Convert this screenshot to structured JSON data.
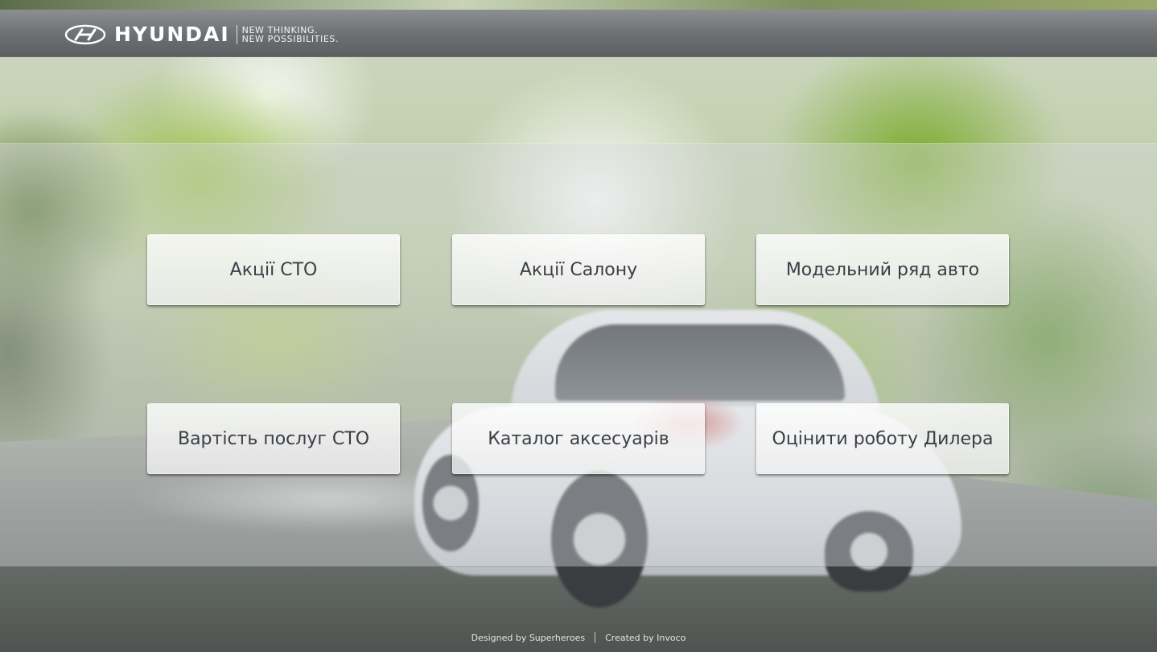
{
  "header": {
    "brand": "HYUNDAI",
    "tagline_line1": "NEW THINKING.",
    "tagline_line2": "NEW POSSIBILITIES."
  },
  "menu": {
    "items": [
      {
        "label": "Акції СТО"
      },
      {
        "label": "Акції Салону"
      },
      {
        "label": "Модельний ряд авто"
      },
      {
        "label": "Вартість послуг СТО"
      },
      {
        "label": "Каталог аксесуарів"
      },
      {
        "label": "Оцінити роботу Дилера"
      }
    ]
  },
  "footer": {
    "designed_by": "Designed by Superheroes",
    "created_by": "Created by Invoco"
  },
  "colors": {
    "header_bar": "#6d7072",
    "tile_text": "#3a3f45",
    "footer_text": "#e4e4e4"
  },
  "icons": {
    "brand_emblem": "hyundai-logo-icon"
  }
}
